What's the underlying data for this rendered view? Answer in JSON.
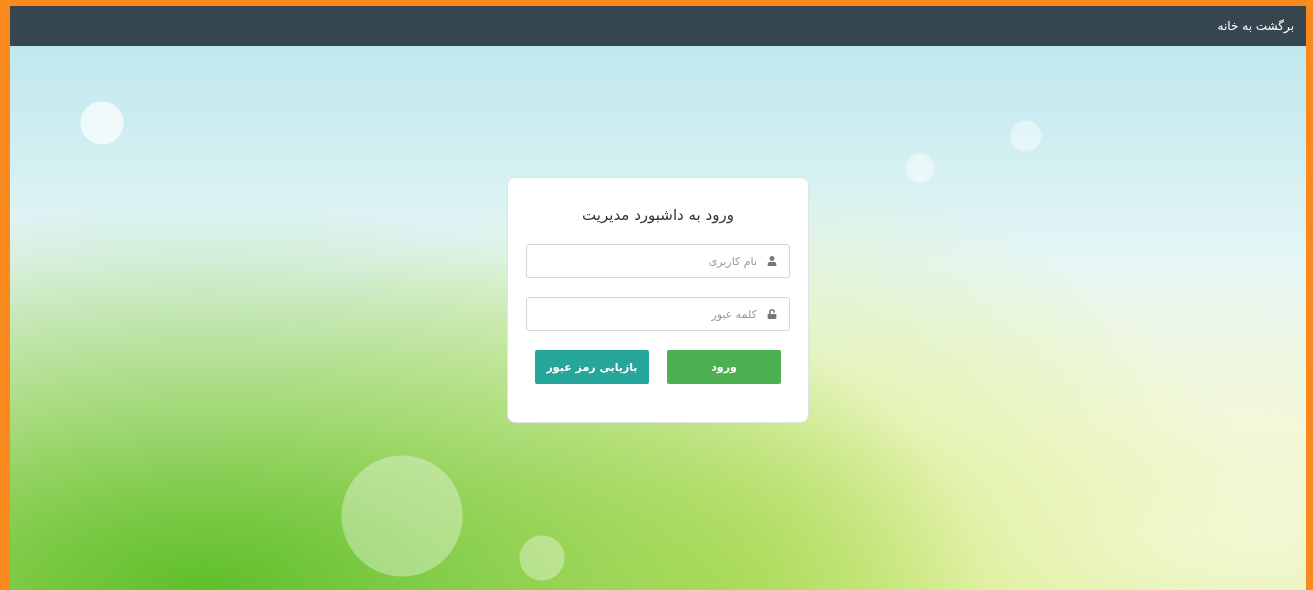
{
  "navbar": {
    "link": "برگشت به خانه"
  },
  "login_card": {
    "title": "ورود به داشبورد مدیریت",
    "fields": [
      {
        "kind": "user",
        "placeholder": "نام کاربری"
      },
      {
        "kind": "password",
        "placeholder": "کلمه عبور"
      }
    ],
    "buttons": [
      {
        "kind": "primary",
        "label": "ورود"
      },
      {
        "kind": "secondary",
        "label": "بازیابی رمز عبور"
      }
    ]
  }
}
